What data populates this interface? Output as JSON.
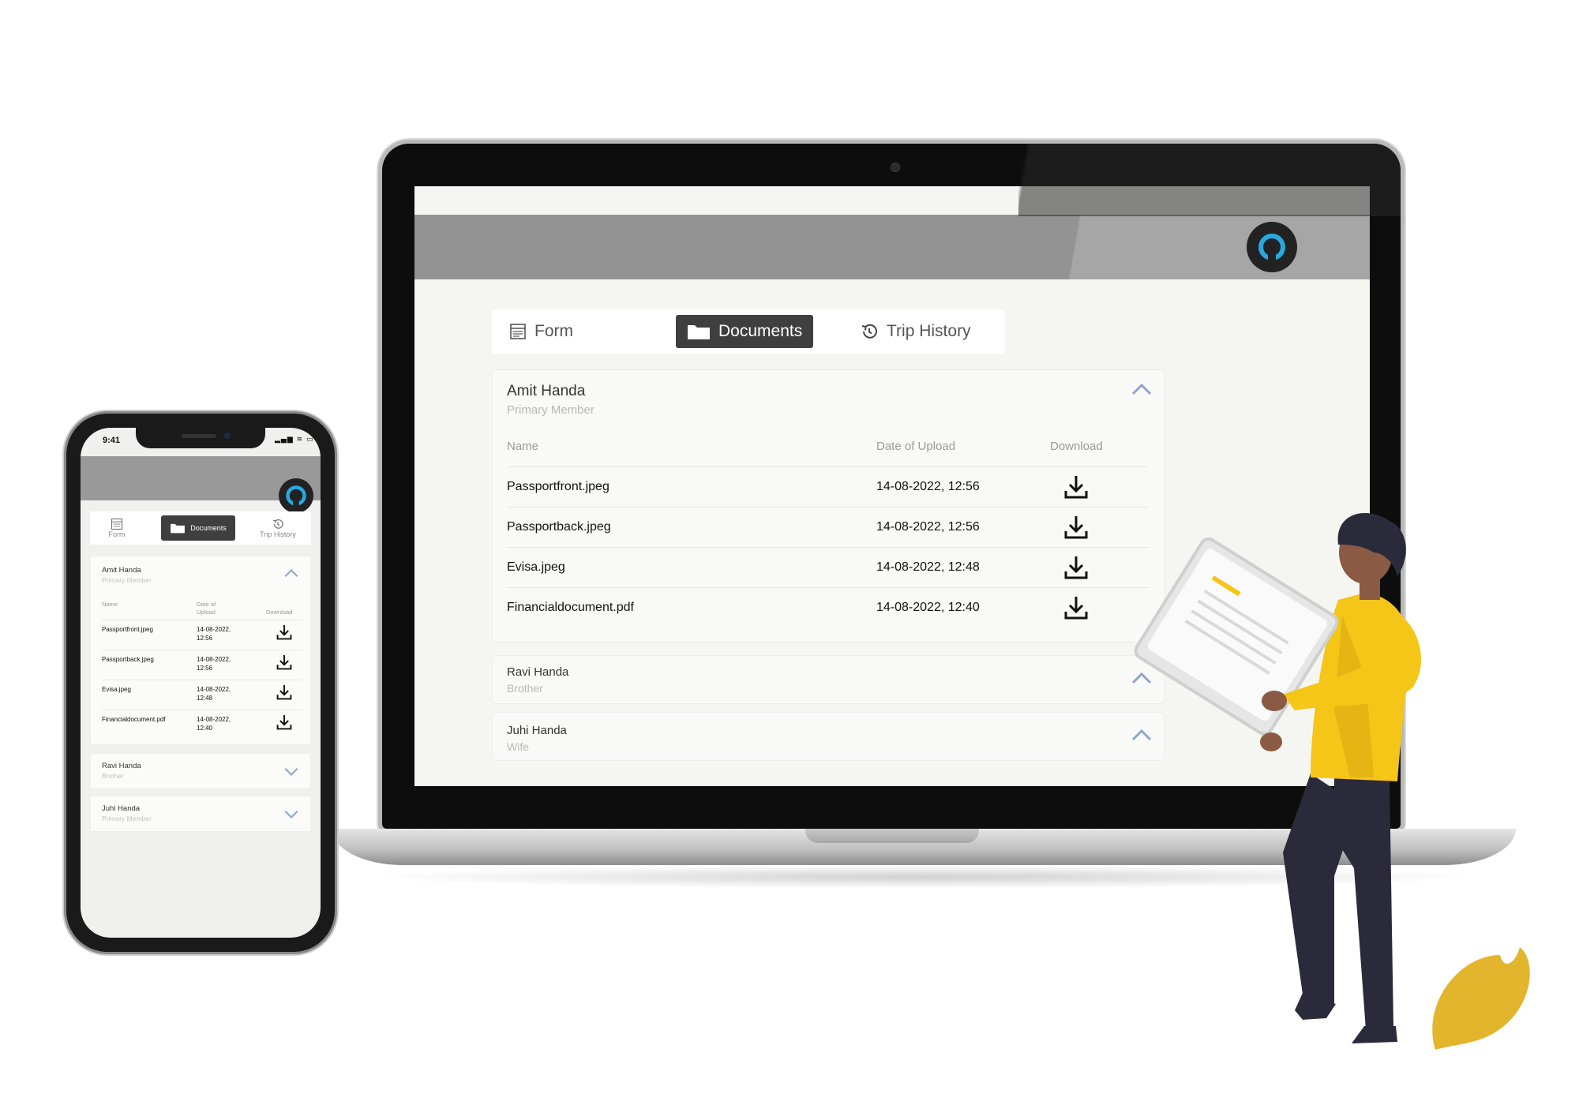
{
  "desktop": {
    "tabs": [
      {
        "label": "Form",
        "icon": "form-icon",
        "active": false
      },
      {
        "label": "Documents",
        "icon": "folder-icon",
        "active": true
      },
      {
        "label": "Trip History",
        "icon": "history-icon",
        "active": false
      }
    ],
    "members": [
      {
        "name": "Amit Handa",
        "relation": "Primary Member",
        "expanded": true,
        "columns": [
          "Name",
          "Date of Upload",
          "Download"
        ],
        "documents": [
          {
            "name": "Passportfront.jpeg",
            "date": "14-08-2022,  12:56"
          },
          {
            "name": "Passportback.jpeg",
            "date": "14-08-2022,  12:56"
          },
          {
            "name": "Evisa.jpeg",
            "date": "14-08-2022,  12:48"
          },
          {
            "name": "Financialdocument.pdf",
            "date": "14-08-2022,  12:40"
          }
        ]
      },
      {
        "name": "Ravi Handa",
        "relation": "Brother",
        "expanded": false
      },
      {
        "name": "Juhi Handa",
        "relation": "Wife",
        "expanded": false
      }
    ]
  },
  "mobile": {
    "status_time": "9:41",
    "tabs": [
      {
        "label": "Form",
        "icon": "form-icon",
        "active": false
      },
      {
        "label": "Documents",
        "icon": "folder-icon",
        "active": true
      },
      {
        "label": "Trip History",
        "icon": "history-icon",
        "active": false
      }
    ],
    "members": [
      {
        "name": "Amit Handa",
        "relation": "Primary Member",
        "columns": [
          "Name",
          "Date of Upload",
          "Download"
        ],
        "documents": [
          {
            "name": "Passportfront.jpeg",
            "date": "14-08-2022, 12:56"
          },
          {
            "name": "Passportback.jpeg",
            "date": "14-08-2022, 12:56"
          },
          {
            "name": "Evisa.jpeg",
            "date": "14-08-2022, 12:48"
          },
          {
            "name": "Financialdocument.pdf",
            "date": "14-08-2022, 12:40"
          }
        ]
      },
      {
        "name": "Ravi Handa",
        "relation": "Brother"
      },
      {
        "name": "Juhi Handa",
        "relation": "Primary Member"
      }
    ]
  },
  "colors": {
    "header": "#939393",
    "active_tab": "#3f3f3f",
    "chevron": "#8ea6cf",
    "avatar_ring": "#29a8e0",
    "accent_yellow": "#f5c518"
  }
}
